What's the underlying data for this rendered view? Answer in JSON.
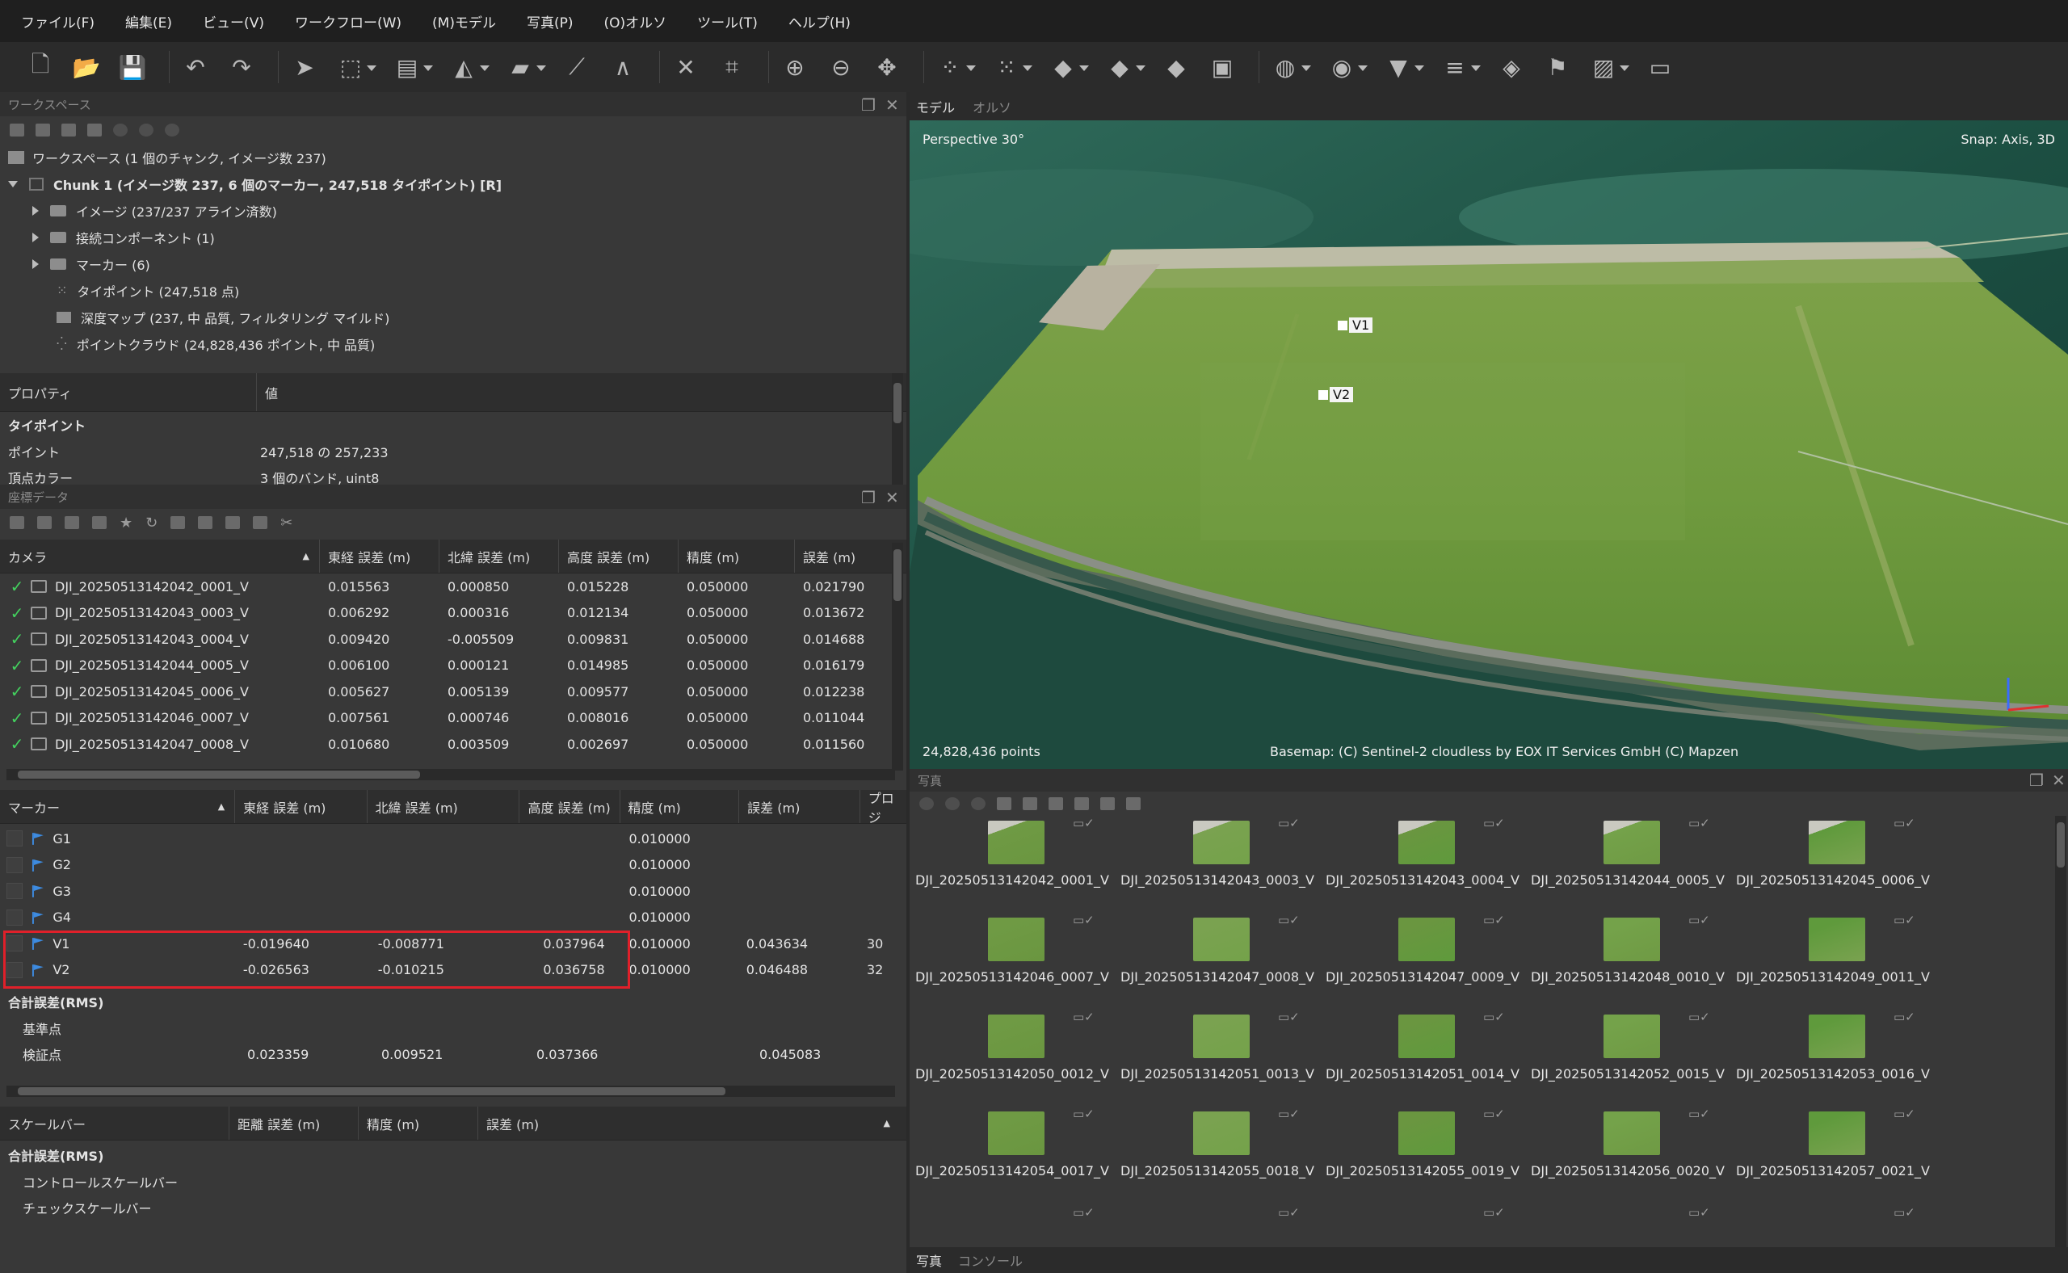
{
  "menu": [
    "ファイル(F)",
    "編集(E)",
    "ビュー(V)",
    "ワークフロー(W)",
    "(M)モデル",
    "写真(P)",
    "(O)オルソ",
    "ツール(T)",
    "ヘルプ(H)"
  ],
  "workspace": {
    "title": "ワークスペース",
    "root": "ワークスペース (1 個のチャンク, イメージ数 237)",
    "chunk": "Chunk 1 (イメージ数 237, 6 個のマーカー, 247,518 タイポイント) [R]",
    "items": [
      "イメージ (237/237 アライン済数)",
      "接続コンポーネント (1)",
      "マーカー (6)",
      "タイポイント (247,518 点)",
      "深度マップ (237, 中 品質, フィルタリング マイルド)",
      "ポイントクラウド (24,828,436 ポイント, 中 品質)"
    ]
  },
  "properties": {
    "col_property": "プロパティ",
    "col_value": "値",
    "section": "タイポイント",
    "rows": [
      {
        "name": "ポイント",
        "value": "247,518 の 257,233"
      },
      {
        "name": "頂点カラー",
        "value": "3 個のバンド, uint8"
      }
    ]
  },
  "reference": {
    "title": "座標データ",
    "camera_headers": [
      "カメラ",
      "東経 誤差 (m)",
      "北緯 誤差 (m)",
      "高度 誤差 (m)",
      "精度 (m)",
      "誤差 (m)"
    ],
    "cameras": [
      [
        "DJI_20250513142042_0001_V",
        "0.015563",
        "0.000850",
        "0.015228",
        "0.050000",
        "0.021790"
      ],
      [
        "DJI_20250513142043_0003_V",
        "0.006292",
        "0.000316",
        "0.012134",
        "0.050000",
        "0.013672"
      ],
      [
        "DJI_20250513142043_0004_V",
        "0.009420",
        "-0.005509",
        "0.009831",
        "0.050000",
        "0.014688"
      ],
      [
        "DJI_20250513142044_0005_V",
        "0.006100",
        "0.000121",
        "0.014985",
        "0.050000",
        "0.016179"
      ],
      [
        "DJI_20250513142045_0006_V",
        "0.005627",
        "0.005139",
        "0.009577",
        "0.050000",
        "0.012238"
      ],
      [
        "DJI_20250513142046_0007_V",
        "0.007561",
        "0.000746",
        "0.008016",
        "0.050000",
        "0.011044"
      ],
      [
        "DJI_20250513142047_0008_V",
        "0.010680",
        "0.003509",
        "0.002697",
        "0.050000",
        "0.011560"
      ]
    ],
    "marker_headers": [
      "マーカー",
      "東経 誤差 (m)",
      "北緯 誤差 (m)",
      "高度 誤差 (m)",
      "精度 (m)",
      "誤差 (m)",
      "プロジ"
    ],
    "markers": [
      [
        "G1",
        "",
        "",
        "",
        "0.010000",
        "",
        ""
      ],
      [
        "G2",
        "",
        "",
        "",
        "0.010000",
        "",
        ""
      ],
      [
        "G3",
        "",
        "",
        "",
        "0.010000",
        "",
        ""
      ],
      [
        "G4",
        "",
        "",
        "",
        "0.010000",
        "",
        ""
      ],
      [
        "V1",
        "-0.019640",
        "-0.008771",
        "0.037964",
        "0.010000",
        "0.043634",
        "30"
      ],
      [
        "V2",
        "-0.026563",
        "-0.010215",
        "0.036758",
        "0.010000",
        "0.046488",
        "32"
      ]
    ],
    "rms_label": "合計誤差(RMS)",
    "rms_rows": [
      [
        "基準点",
        "",
        "",
        "",
        "",
        ""
      ],
      [
        "検証点",
        "0.023359",
        "0.009521",
        "0.037366",
        "",
        "0.045083"
      ]
    ],
    "scalebar_headers": [
      "スケールバー",
      "距離 誤差 (m)",
      "精度 (m)",
      "誤差 (m)"
    ],
    "scalebar_rms": "合計誤差(RMS)",
    "scalebar_rows": [
      "コントロールスケールバー",
      "チェックスケールバー"
    ]
  },
  "viewport": {
    "tabs": [
      "モデル",
      "オルソ"
    ],
    "projection": "Perspective 30°",
    "snap": "Snap: Axis, 3D",
    "points": "24,828,436 points",
    "basemap": "Basemap: (C) Sentinel-2 cloudless by EOX IT Services GmbH (C) Mapzen",
    "marker_labels": [
      "V1",
      "V2"
    ]
  },
  "photos": {
    "title": "写真",
    "items": [
      "DJI_20250513142042_0001_V",
      "DJI_20250513142043_0003_V",
      "DJI_20250513142043_0004_V",
      "DJI_20250513142044_0005_V",
      "DJI_20250513142045_0006_V",
      "DJI_20250513142046_0007_V",
      "DJI_20250513142047_0008_V",
      "DJI_20250513142047_0009_V",
      "DJI_20250513142048_0010_V",
      "DJI_20250513142049_0011_V",
      "DJI_20250513142050_0012_V",
      "DJI_20250513142051_0013_V",
      "DJI_20250513142051_0014_V",
      "DJI_20250513142052_0015_V",
      "DJI_20250513142053_0016_V",
      "DJI_20250513142054_0017_V",
      "DJI_20250513142055_0018_V",
      "DJI_20250513142055_0019_V",
      "DJI_20250513142056_0020_V",
      "DJI_20250513142057_0021_V"
    ],
    "bottom_tabs": [
      "写真",
      "コンソール"
    ]
  },
  "colors": {
    "highlight": "#e0202a",
    "check": "#43d15e",
    "flag": "#3d8be0"
  }
}
